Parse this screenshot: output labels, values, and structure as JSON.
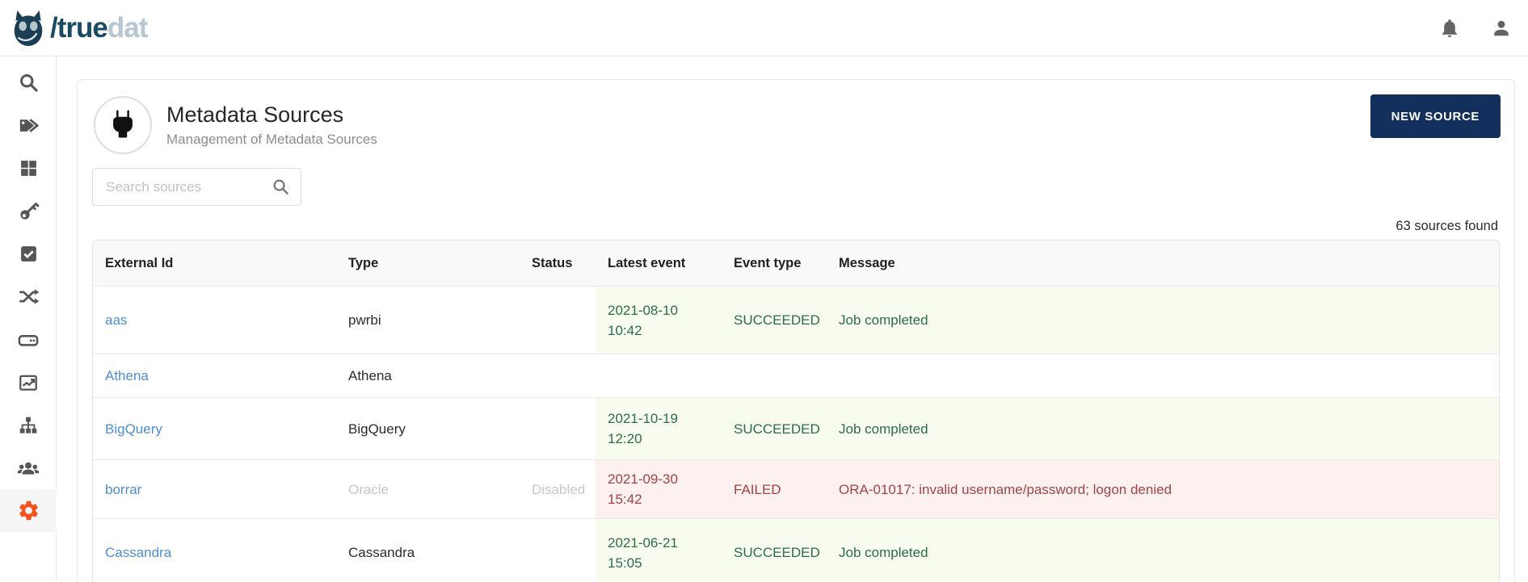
{
  "brand": {
    "logo_icon": "owl-icon",
    "logo_text_dark": "/true",
    "logo_text_light": "dat"
  },
  "topbar": {
    "icons": [
      "bell-icon",
      "user-profile-icon"
    ]
  },
  "sidebar": {
    "items": [
      {
        "icon": "search-icon",
        "active": false
      },
      {
        "icon": "tags-icon",
        "active": false
      },
      {
        "icon": "grid-icon",
        "active": false
      },
      {
        "icon": "key-icon",
        "active": false
      },
      {
        "icon": "check-square-icon",
        "active": false
      },
      {
        "icon": "shuffle-icon",
        "active": false
      },
      {
        "icon": "drive-icon",
        "active": false
      },
      {
        "icon": "chart-line-icon",
        "active": false
      },
      {
        "icon": "sitemap-icon",
        "active": false
      },
      {
        "icon": "users-icon",
        "active": false
      },
      {
        "icon": "gear-icon",
        "active": true
      }
    ]
  },
  "page": {
    "header_icon": "plug-icon",
    "title": "Metadata Sources",
    "subtitle": "Management of Metadata Sources",
    "new_source_label": "NEW SOURCE",
    "search_placeholder": "Search sources",
    "results_count": "63 sources found"
  },
  "table": {
    "columns": [
      "External Id",
      "Type",
      "Status",
      "Latest event",
      "Event type",
      "Message"
    ],
    "rows": [
      {
        "external_id": "aas",
        "type": "pwrbi",
        "status": "",
        "latest_event": "2021-08-10 10:42",
        "event_type": "SUCCEEDED",
        "message": "Job completed",
        "state": "success"
      },
      {
        "external_id": "Athena",
        "type": "Athena",
        "status": "",
        "latest_event": "",
        "event_type": "",
        "message": "",
        "state": "none"
      },
      {
        "external_id": "BigQuery",
        "type": "BigQuery",
        "status": "",
        "latest_event": "2021-10-19 12:20",
        "event_type": "SUCCEEDED",
        "message": "Job completed",
        "state": "success"
      },
      {
        "external_id": "borrar",
        "type": "Oracle",
        "status": "Disabled",
        "latest_event": "2021-09-30 15:42",
        "event_type": "FAILED",
        "message": "ORA-01017: invalid username/password; logon denied",
        "state": "failed",
        "disabled": true
      },
      {
        "external_id": "Cassandra",
        "type": "Cassandra",
        "status": "",
        "latest_event": "2021-06-21 15:05",
        "event_type": "SUCCEEDED",
        "message": "Job completed",
        "state": "success"
      }
    ]
  },
  "colors": {
    "accent_orange": "#f4511e",
    "button_navy": "#122f5d",
    "link_blue": "#4d8fd3",
    "success_bg": "#f8fcef",
    "success_text": "#2d6a4e",
    "error_bg": "#fdf1f0",
    "error_text": "#a04345",
    "logo_dark": "#1b4a63",
    "logo_light": "#b7c7d0"
  }
}
